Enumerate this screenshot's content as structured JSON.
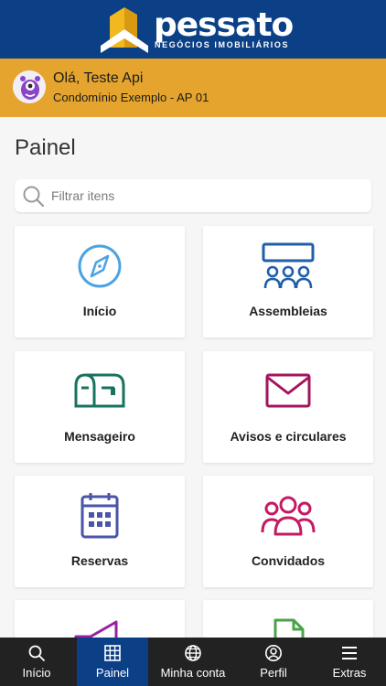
{
  "header": {
    "logo_text": "pessato",
    "logo_subtitle": "NEGÓCIOS IMOBILIÁRIOS",
    "brand_color": "#0b3f86",
    "accent_color": "#e4a42e"
  },
  "user": {
    "greeting": "Olá, Teste Api",
    "unit": "Condomínio Exemplo - AP 01",
    "avatar_icon": "purple-monster-avatar"
  },
  "page": {
    "title": "Painel"
  },
  "search": {
    "placeholder": "Filtrar itens",
    "value": ""
  },
  "tiles": [
    {
      "label": "Início",
      "icon": "compass-icon",
      "color": "#4ba3e3"
    },
    {
      "label": "Assembleias",
      "icon": "meeting-icon",
      "color": "#1f5fa8"
    },
    {
      "label": "Mensageiro",
      "icon": "mailbox-icon",
      "color": "#17735f"
    },
    {
      "label": "Avisos e circulares",
      "icon": "envelope-icon",
      "color": "#a3155e"
    },
    {
      "label": "Reservas",
      "icon": "calendar-icon",
      "color": "#4a55a8"
    },
    {
      "label": "Convidados",
      "icon": "people-icon",
      "color": "#c41a64"
    },
    {
      "label": "",
      "icon": "megaphone-icon",
      "color": "#9b1fa3"
    },
    {
      "label": "",
      "icon": "document-icon",
      "color": "#4aa34a"
    }
  ],
  "bottom_nav": {
    "items": [
      {
        "label": "Início",
        "icon": "search-icon",
        "active": false
      },
      {
        "label": "Painel",
        "icon": "grid-icon",
        "active": true
      },
      {
        "label": "Minha conta",
        "icon": "globe-icon",
        "active": false
      },
      {
        "label": "Perfil",
        "icon": "user-circle-icon",
        "active": false
      },
      {
        "label": "Extras",
        "icon": "menu-icon",
        "active": false
      }
    ]
  }
}
